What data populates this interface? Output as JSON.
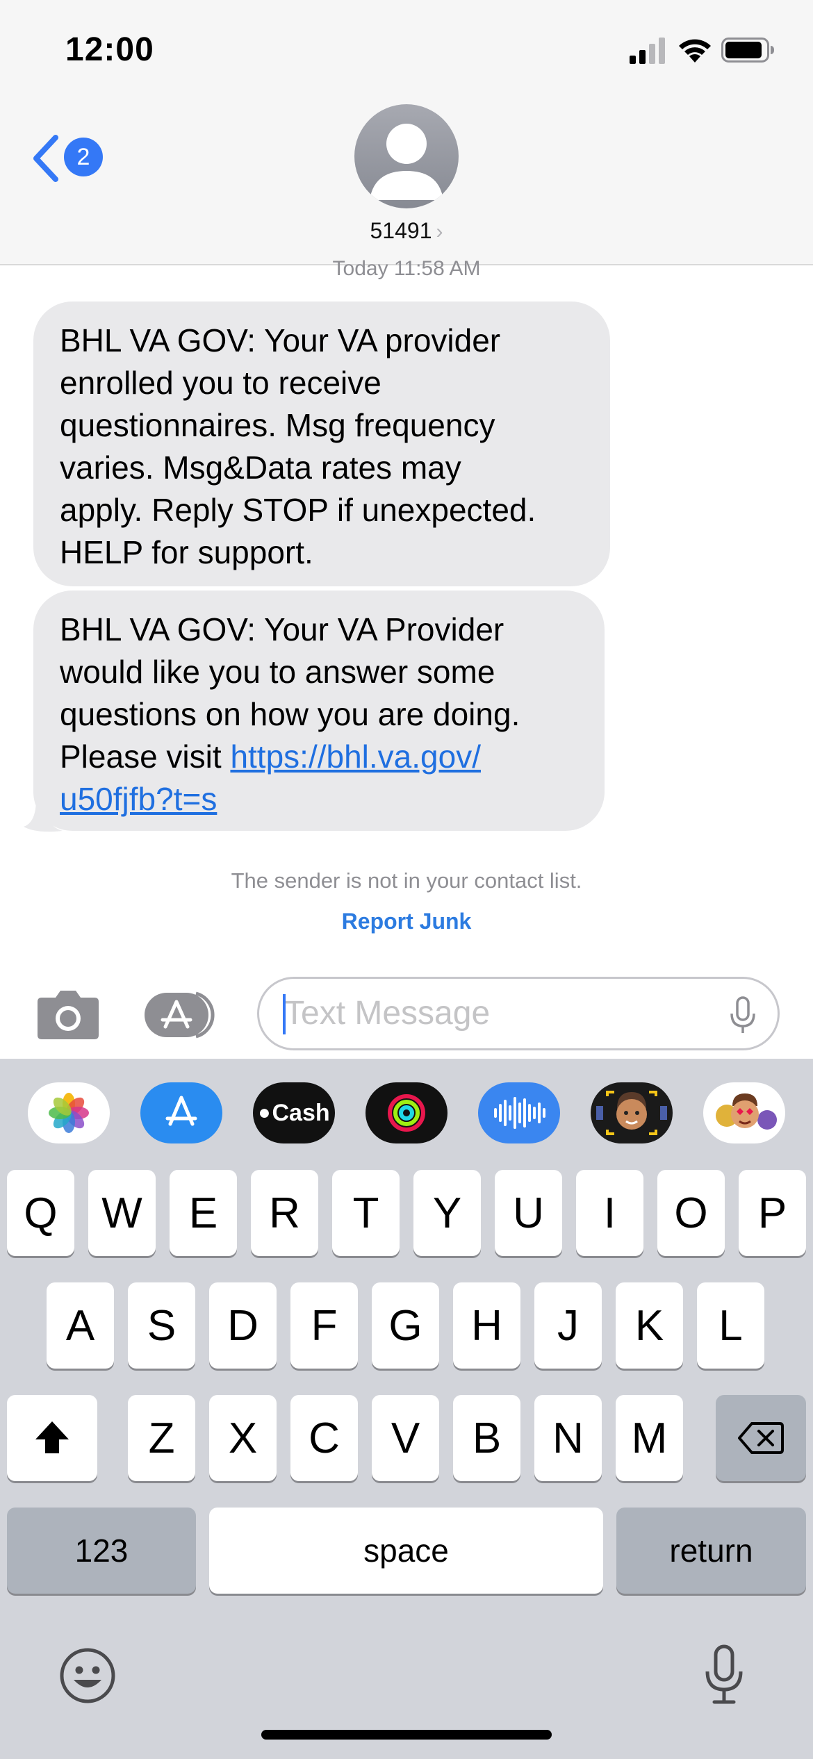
{
  "status_bar": {
    "time": "12:00"
  },
  "nav": {
    "back_badge": "2",
    "contact_name": "51491",
    "contact_chevron": "›"
  },
  "conversation": {
    "timestamp": "Today 11:58 AM",
    "messages": [
      {
        "lines": [
          "BHL VA GOV: Your VA provider",
          "enrolled you to receive",
          "questionnaires. Msg frequency",
          "varies. Msg&Data rates may",
          "apply. Reply STOP if unexpected.",
          "HELP for support."
        ]
      },
      {
        "lines": [
          "BHL VA GOV: Your VA Provider",
          "would like you to answer some",
          "questions on how you are doing."
        ],
        "line4_prefix": "Please visit ",
        "link_line1": "https://bhl.va.gov/",
        "link_line2": "u50fjfb?t=s"
      }
    ],
    "sender_note": "The sender is not in your contact list.",
    "report_junk": "Report Junk"
  },
  "input": {
    "placeholder": "Text Message"
  },
  "app_strip": {
    "apps": [
      "photos-app",
      "app-store-app",
      "apple-cash-app",
      "activity-app",
      "audio-message-app",
      "memoji-app",
      "memoji-stickers-app"
    ],
    "cash_label": "Cash"
  },
  "keyboard": {
    "row1": [
      "Q",
      "W",
      "E",
      "R",
      "T",
      "Y",
      "U",
      "I",
      "O",
      "P"
    ],
    "row2": [
      "A",
      "S",
      "D",
      "F",
      "G",
      "H",
      "J",
      "K",
      "L"
    ],
    "row3": [
      "Z",
      "X",
      "C",
      "V",
      "B",
      "N",
      "M"
    ],
    "numbers_label": "123",
    "space_label": "space",
    "return_label": "return"
  },
  "colors": {
    "accent": "#3478f6",
    "bubble_received": "#e9e9eb",
    "keyboard_bg": "#d2d4da",
    "header_bg": "#f6f6f6"
  }
}
